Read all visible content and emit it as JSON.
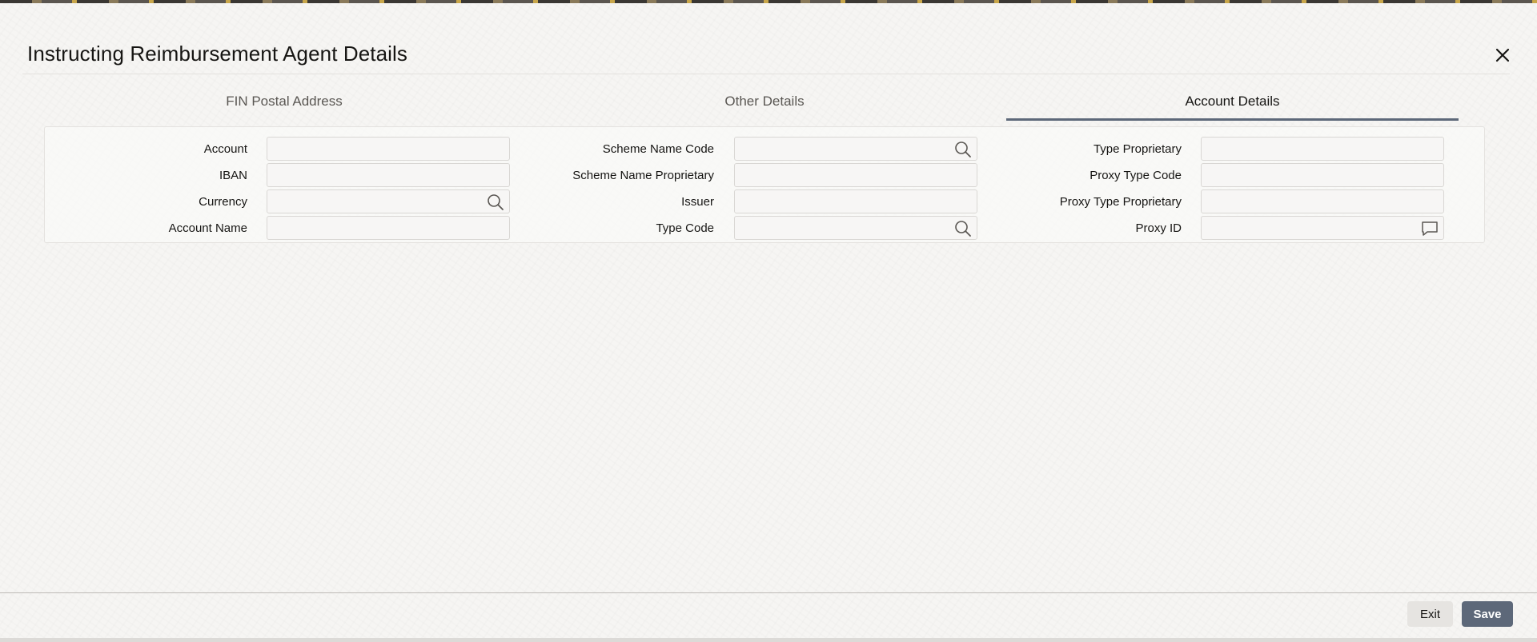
{
  "dialog": {
    "title": "Instructing Reimbursement Agent Details",
    "close_icon": "close-icon"
  },
  "tabs": [
    {
      "label": "FIN Postal Address",
      "active": false
    },
    {
      "label": "Other Details",
      "active": false
    },
    {
      "label": "Account Details",
      "active": true
    }
  ],
  "form": {
    "account": {
      "label": "Account",
      "value": ""
    },
    "iban": {
      "label": "IBAN",
      "value": ""
    },
    "currency": {
      "label": "Currency",
      "value": "",
      "icon": "search-icon"
    },
    "account_name": {
      "label": "Account Name",
      "value": ""
    },
    "scheme_name_code": {
      "label": "Scheme Name Code",
      "value": "",
      "icon": "search-icon"
    },
    "scheme_name_proprietary": {
      "label": "Scheme Name Proprietary",
      "value": ""
    },
    "issuer": {
      "label": "Issuer",
      "value": ""
    },
    "type_code": {
      "label": "Type Code",
      "value": "",
      "icon": "search-icon"
    },
    "type_proprietary": {
      "label": "Type Proprietary",
      "value": ""
    },
    "proxy_type_code": {
      "label": "Proxy Type Code",
      "value": ""
    },
    "proxy_type_proprietary": {
      "label": "Proxy Type Proprietary",
      "value": ""
    },
    "proxy_id": {
      "label": "Proxy ID",
      "value": "",
      "icon": "comment-icon"
    }
  },
  "footer": {
    "exit_label": "Exit",
    "save_label": "Save"
  },
  "colors": {
    "accent": "#5d6879",
    "background": "#f6f5f3",
    "input_border": "#d9d7d4"
  }
}
